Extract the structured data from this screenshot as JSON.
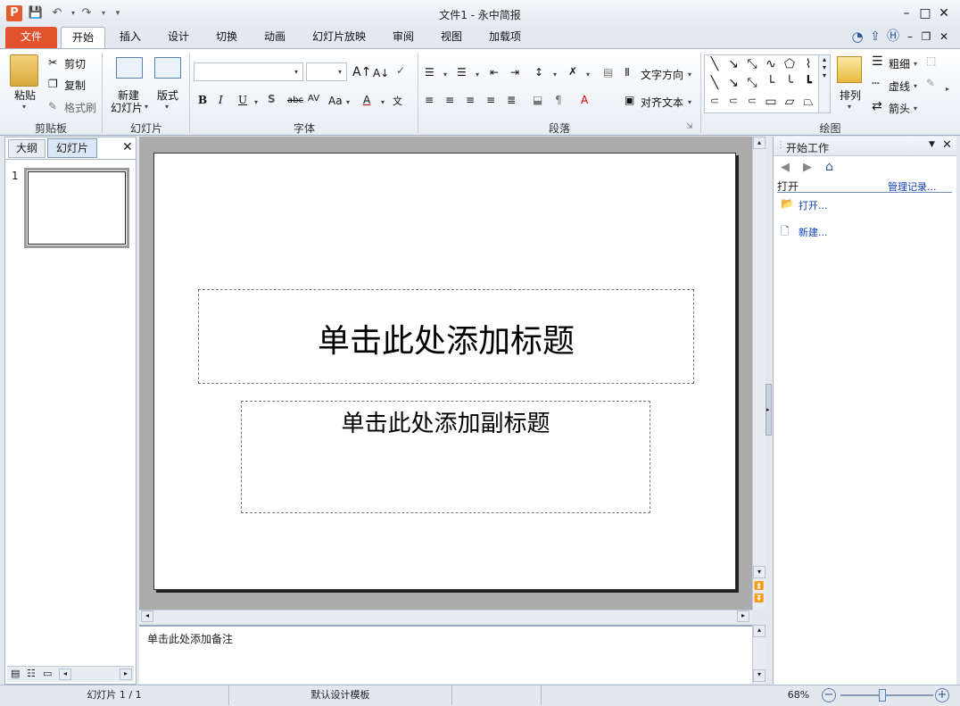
{
  "window": {
    "title": "文件1 - 永中简报"
  },
  "quick_access": [
    "app-logo-icon",
    "save-icon",
    "undo-icon",
    "redo-icon",
    "customize-icon"
  ],
  "tabs": [
    "文件",
    "开始",
    "插入",
    "设计",
    "切换",
    "动画",
    "幻灯片放映",
    "审阅",
    "视图",
    "加载项"
  ],
  "ribbon": {
    "clipboard": {
      "paste": "粘贴",
      "cut": "剪切",
      "copy": "复制",
      "format_painter": "格式刷",
      "group": "剪贴板"
    },
    "slides": {
      "new_line1": "新建",
      "new_line2": "幻灯片",
      "layout": "版式",
      "group": "幻灯片"
    },
    "font": {
      "family": "",
      "size": "",
      "group": "字体"
    },
    "paragraph": {
      "text_direction": "文字方向",
      "align_text": "对齐文本",
      "group": "段落"
    },
    "drawing": {
      "arrange": "排列",
      "weight": "粗细",
      "dashes": "虚线",
      "arrows": "箭头",
      "group": "绘图"
    }
  },
  "slide_panel": {
    "tab_outline": "大纲",
    "tab_slides": "幻灯片",
    "slide_number": "1"
  },
  "slide": {
    "title_placeholder": "单击此处添加标题",
    "subtitle_placeholder": "单击此处添加副标题"
  },
  "notes": {
    "placeholder": "单击此处添加备注"
  },
  "task_pane": {
    "title": "开始工作",
    "open_section": "打开",
    "manage": "管理记录...",
    "open_link": "打开...",
    "new_link": "新建..."
  },
  "status": {
    "slide": "幻灯片 1 / 1",
    "template": "默认设计模板",
    "zoom": "68%",
    "zoom_level": 0.45
  },
  "colors": {
    "file_tab": "#e2522c",
    "accent": "#2b5797"
  }
}
